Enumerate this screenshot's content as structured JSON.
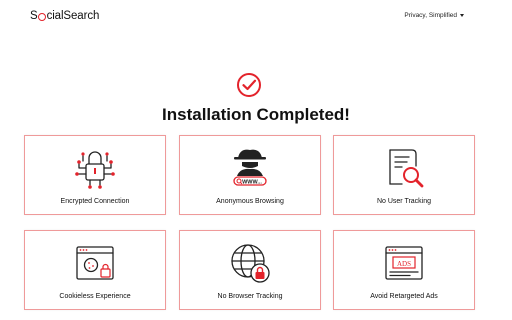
{
  "header": {
    "logo_prefix": "S",
    "logo_suffix": "cialSearch",
    "menu_label": "Privacy, Simplified"
  },
  "main": {
    "title": "Installation Completed!"
  },
  "features": [
    {
      "label": "Encrypted Connection",
      "icon": "lock-circuit-icon"
    },
    {
      "label": "Anonymous Browsing",
      "icon": "spy-icon",
      "badge": "WWW..."
    },
    {
      "label": "No User Tracking",
      "icon": "document-search-icon"
    },
    {
      "label": "Cookieless Experience",
      "icon": "cookie-browser-icon"
    },
    {
      "label": "No Browser Tracking",
      "icon": "globe-lock-icon"
    },
    {
      "label": "Avoid Retargeted Ads",
      "icon": "ads-browser-icon",
      "badge": "ADS"
    }
  ],
  "colors": {
    "accent": "#e3232b",
    "border": "#ef9a9a",
    "text": "#111111"
  }
}
